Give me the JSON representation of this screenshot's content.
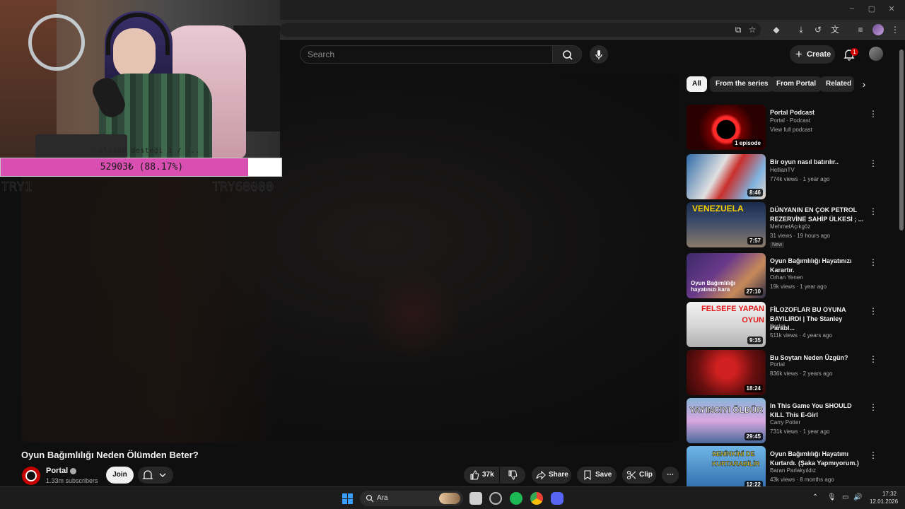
{
  "search": {
    "placeholder": "Search"
  },
  "header": {
    "create_label": "Create",
    "notification_count": "1"
  },
  "overlay": {
    "caption": "...alışan desteği 1 / ...",
    "goal_text": "52903₺ (88.17%)",
    "goal_fraction": 0.8817,
    "goal_min": "TRY1",
    "goal_max": "TRY60000"
  },
  "video": {
    "title": "Oyun Bağımlılığı Neden Ölümden Beter?",
    "channel": "Portal",
    "subscribers": "1.33m subscribers",
    "join_label": "Join",
    "likes": "37k",
    "share_label": "Share",
    "save_label": "Save",
    "clip_label": "Clip"
  },
  "chips": [
    "All",
    "From the series",
    "From Portal",
    "Related"
  ],
  "recommendations": [
    {
      "title": "Portal Podcast",
      "channel": "Portal · Podcast",
      "meta": "View full podcast",
      "badge": "",
      "duration": "1 episode",
      "thumb": "podcast"
    },
    {
      "title": "Bir oyun nasıl batırılır..",
      "channel": "HellianTV",
      "meta": "774k views · 1 year ago",
      "badge": "",
      "duration": "8:46",
      "thumb": "hellian"
    },
    {
      "title": "DÜNYANIN EN ÇOK PETROL REZERVİNE SAHİP ÜLKESİ ; ...",
      "channel": "MehmetAçıkgöz",
      "meta": "31 views · 19 hours ago",
      "badge": "New",
      "duration": "7:57",
      "thumb": "venezuela"
    },
    {
      "title": "Oyun Bağımlılığı Hayatınızı Karartır.",
      "channel": "Orhan Yenen",
      "meta": "19k views · 1 year ago",
      "badge": "",
      "duration": "27:10",
      "thumb": "orhan"
    },
    {
      "title": "FİLOZOFLAR BU OYUNA BAYILIRDI | The Stanley Parabl...",
      "channel": "Portal",
      "meta": "511k views · 4 years ago",
      "badge": "",
      "duration": "9:35",
      "thumb": "felsefe"
    },
    {
      "title": "Bu Soytarı Neden Üzgün?",
      "channel": "Portal",
      "meta": "836k views · 2 years ago",
      "badge": "",
      "duration": "18:24",
      "thumb": "soytari"
    },
    {
      "title": "In This Game You SHOULD KILL This E-Girl",
      "channel": "Carry Potter",
      "meta": "731k views · 1 year ago",
      "badge": "",
      "duration": "29:45",
      "thumb": "egirl"
    },
    {
      "title": "Oyun Bağımlılığı Hayatımı Kurtardı. (Şaka Yapmıyorum.)",
      "channel": "Baran Parlakyıldız",
      "meta": "43k views · 8 months ago",
      "badge": "",
      "duration": "12:22",
      "thumb": "kurtar"
    }
  ],
  "thumb_text": {
    "venezuela": "VENEZUELA",
    "orhan": "Oyun Bağımlılığı hayatınızı kara",
    "felsefe": "FELSEFE YAPAN OYUN",
    "egirl": "YAYINCIYI ÖLDÜR",
    "kurtar": "SENİNKİNİ DE KURTARABİLİR"
  },
  "taskbar": {
    "search_label": "Ara",
    "time": "17:32",
    "date": "12.01.2026"
  },
  "colors": {
    "goal_fill": "#d84fb1",
    "youtube_red": "#cc0000"
  }
}
